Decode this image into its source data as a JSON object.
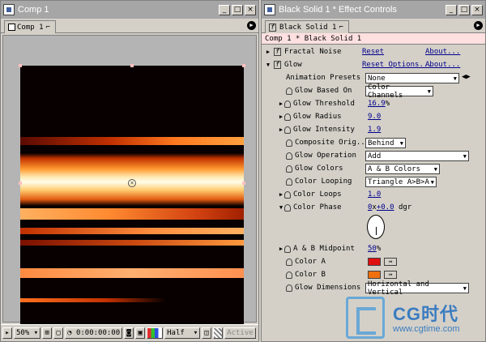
{
  "comp_window": {
    "title": "Comp 1",
    "tab": "Comp 1",
    "statusbar": {
      "zoom": "50%",
      "timecode": "0:00:00:00",
      "resolution": "Half",
      "active_label": "Active"
    }
  },
  "effects_window": {
    "title": "Black Solid 1 * Effect Controls",
    "tab": "Black Solid 1",
    "header": "Comp 1 * Black Solid 1",
    "effects": {
      "fractal_noise": {
        "name": "Fractal Noise",
        "reset": "Reset",
        "about": "About..."
      },
      "glow": {
        "name": "Glow",
        "reset": "Reset Options...",
        "about": "About..."
      }
    },
    "animation_presets": {
      "label": "Animation Presets",
      "value": "None"
    },
    "params": {
      "glow_based_on": {
        "label": "Glow Based On",
        "value": "Color Channels"
      },
      "glow_threshold": {
        "label": "Glow Threshold",
        "value": "16.9",
        "unit": "%"
      },
      "glow_radius": {
        "label": "Glow Radius",
        "value": "9.0"
      },
      "glow_intensity": {
        "label": "Glow Intensity",
        "value": "1.9"
      },
      "composite_original": {
        "label": "Composite Orig...",
        "value": "Behind"
      },
      "glow_operation": {
        "label": "Glow Operation",
        "value": "Add"
      },
      "glow_colors": {
        "label": "Glow Colors",
        "value": "A & B Colors"
      },
      "color_looping": {
        "label": "Color Looping",
        "value": "Triangle A>B>A"
      },
      "color_loops": {
        "label": "Color Loops",
        "value": "1.0"
      },
      "color_phase": {
        "label": "Color Phase",
        "revolutions": "0",
        "sep": "x",
        "degrees": "+0.0",
        "unit": "dgr"
      },
      "ab_midpoint": {
        "label": "A & B Midpoint",
        "value": "50",
        "unit": "%"
      },
      "color_a": {
        "label": "Color A",
        "color": "#e01010"
      },
      "color_b": {
        "label": "Color B",
        "color": "#f07010"
      },
      "glow_dimensions": {
        "label": "Glow Dimensions",
        "value": "Horizontal and Vertical"
      }
    }
  },
  "watermark": {
    "brand": "CG时代",
    "url": "www.cgtime.com"
  },
  "icons": {
    "window": "ae-window-icon",
    "minimize": "minimize-icon",
    "maximize": "maximize-icon",
    "close": "close-icon",
    "stopwatch": "stopwatch-icon",
    "eyedropper": "eyedropper-icon"
  }
}
